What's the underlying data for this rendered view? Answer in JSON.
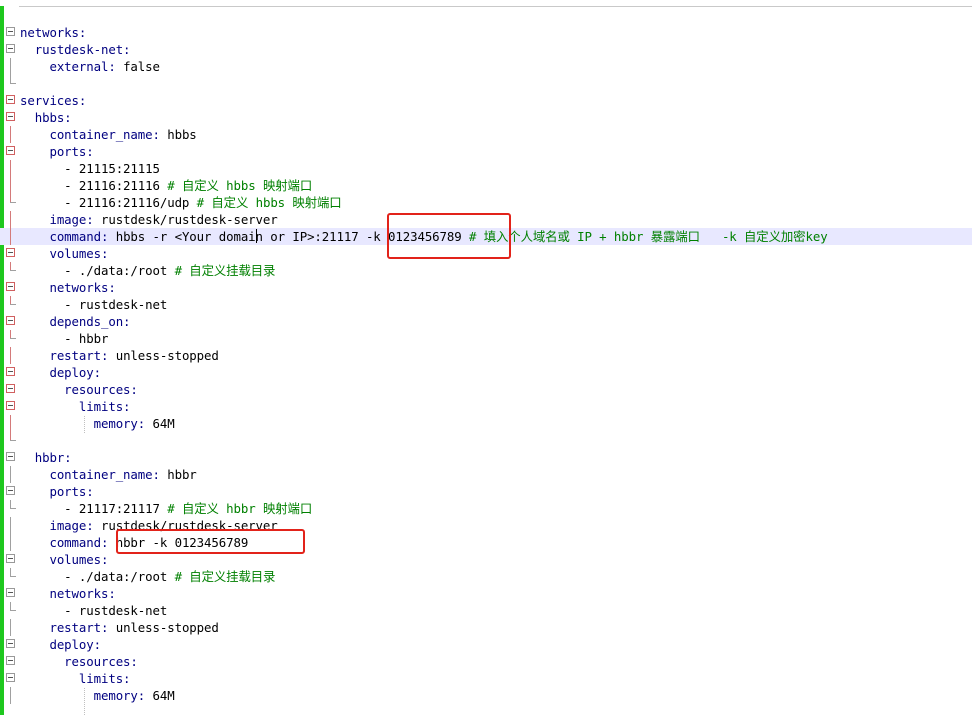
{
  "editor": {
    "lines": [
      {
        "indent": "",
        "key": "networks",
        "sep": ":",
        "value": "",
        "comment": ""
      },
      {
        "indent": "  ",
        "key": "rustdesk-net",
        "sep": ":",
        "value": "",
        "comment": ""
      },
      {
        "indent": "    ",
        "key": "external",
        "sep": ": ",
        "value": "false",
        "comment": ""
      },
      {
        "indent": "",
        "key": "",
        "sep": "",
        "value": "",
        "comment": ""
      },
      {
        "indent": "",
        "key": "services",
        "sep": ":",
        "value": "",
        "comment": ""
      },
      {
        "indent": "  ",
        "key": "hbbs",
        "sep": ":",
        "value": "",
        "comment": ""
      },
      {
        "indent": "    ",
        "key": "container_name",
        "sep": ": ",
        "value": "hbbs",
        "comment": ""
      },
      {
        "indent": "    ",
        "key": "ports",
        "sep": ":",
        "value": "",
        "comment": ""
      },
      {
        "indent": "      ",
        "key": "",
        "sep": "",
        "value": "- 21115:21115",
        "comment": ""
      },
      {
        "indent": "      ",
        "key": "",
        "sep": "",
        "value": "- 21116:21116 ",
        "comment": "# 自定义 hbbs 映射端口"
      },
      {
        "indent": "      ",
        "key": "",
        "sep": "",
        "value": "- 21116:21116/udp ",
        "comment": "# 自定义 hbbs 映射端口"
      },
      {
        "indent": "    ",
        "key": "image",
        "sep": ": ",
        "value": "rustdesk/rustdesk-server",
        "comment": ""
      },
      {
        "indent": "    ",
        "key": "command",
        "sep": ": ",
        "value": "hbbs -r <Your domain or IP>:21117 -k 0123456789 ",
        "comment": "# 填入个人域名或 IP + hbbr 暴露端口   -k 自定义加密key"
      },
      {
        "indent": "    ",
        "key": "volumes",
        "sep": ":",
        "value": "",
        "comment": ""
      },
      {
        "indent": "      ",
        "key": "",
        "sep": "",
        "value": "- ./data:/root ",
        "comment": "# 自定义挂载目录"
      },
      {
        "indent": "    ",
        "key": "networks",
        "sep": ":",
        "value": "",
        "comment": ""
      },
      {
        "indent": "      ",
        "key": "",
        "sep": "",
        "value": "- rustdesk-net",
        "comment": ""
      },
      {
        "indent": "    ",
        "key": "depends_on",
        "sep": ":",
        "value": "",
        "comment": ""
      },
      {
        "indent": "      ",
        "key": "",
        "sep": "",
        "value": "- hbbr",
        "comment": ""
      },
      {
        "indent": "    ",
        "key": "restart",
        "sep": ": ",
        "value": "unless-stopped",
        "comment": ""
      },
      {
        "indent": "    ",
        "key": "deploy",
        "sep": ":",
        "value": "",
        "comment": ""
      },
      {
        "indent": "      ",
        "key": "resources",
        "sep": ":",
        "value": "",
        "comment": ""
      },
      {
        "indent": "        ",
        "key": "limits",
        "sep": ":",
        "value": "",
        "comment": ""
      },
      {
        "indent": "          ",
        "key": "memory",
        "sep": ": ",
        "value": "64M",
        "comment": ""
      },
      {
        "indent": "",
        "key": "",
        "sep": "",
        "value": "",
        "comment": ""
      },
      {
        "indent": "  ",
        "key": "hbbr",
        "sep": ":",
        "value": "",
        "comment": ""
      },
      {
        "indent": "    ",
        "key": "container_name",
        "sep": ": ",
        "value": "hbbr",
        "comment": ""
      },
      {
        "indent": "    ",
        "key": "ports",
        "sep": ":",
        "value": "",
        "comment": ""
      },
      {
        "indent": "      ",
        "key": "",
        "sep": "",
        "value": "- 21117:21117 ",
        "comment": "# 自定义 hbbr 映射端口"
      },
      {
        "indent": "    ",
        "key": "image",
        "sep": ": ",
        "value": "rustdesk/rustdesk-server",
        "comment": ""
      },
      {
        "indent": "    ",
        "key": "command",
        "sep": ": ",
        "value": "hbbr -k 0123456789",
        "comment": ""
      },
      {
        "indent": "    ",
        "key": "volumes",
        "sep": ":",
        "value": "",
        "comment": ""
      },
      {
        "indent": "      ",
        "key": "",
        "sep": "",
        "value": "- ./data:/root ",
        "comment": "# 自定义挂载目录"
      },
      {
        "indent": "    ",
        "key": "networks",
        "sep": ":",
        "value": "",
        "comment": ""
      },
      {
        "indent": "      ",
        "key": "",
        "sep": "",
        "value": "- rustdesk-net",
        "comment": ""
      },
      {
        "indent": "    ",
        "key": "restart",
        "sep": ": ",
        "value": "unless-stopped",
        "comment": ""
      },
      {
        "indent": "    ",
        "key": "deploy",
        "sep": ":",
        "value": "",
        "comment": ""
      },
      {
        "indent": "      ",
        "key": "resources",
        "sep": ":",
        "value": "",
        "comment": ""
      },
      {
        "indent": "        ",
        "key": "limits",
        "sep": ":",
        "value": "",
        "comment": ""
      },
      {
        "indent": "          ",
        "key": "memory",
        "sep": ": ",
        "value": "64M",
        "comment": ""
      }
    ],
    "fold_markers": [
      "box",
      "box",
      "line",
      "end",
      "box-red",
      "box-red",
      "line-red",
      "box-red",
      "line-red",
      "line-red",
      "end-red",
      "line-red",
      "line-red",
      "box-red",
      "end-red",
      "box-red",
      "end-red",
      "box-red",
      "end-red",
      "line-red",
      "box-red",
      "box-red",
      "box-red",
      "line-red",
      "end-red",
      "box",
      "line",
      "box",
      "end",
      "line",
      "line",
      "box",
      "end",
      "box",
      "end",
      "line",
      "box",
      "box",
      "box",
      "line"
    ],
    "highlighted_line": 12,
    "colors": {
      "key": "#000080",
      "value": "#000000",
      "comment": "#008000",
      "highlight": "#e8e8ff",
      "annotation": "#e2231a",
      "fold_bar": "#1ec81e"
    }
  }
}
